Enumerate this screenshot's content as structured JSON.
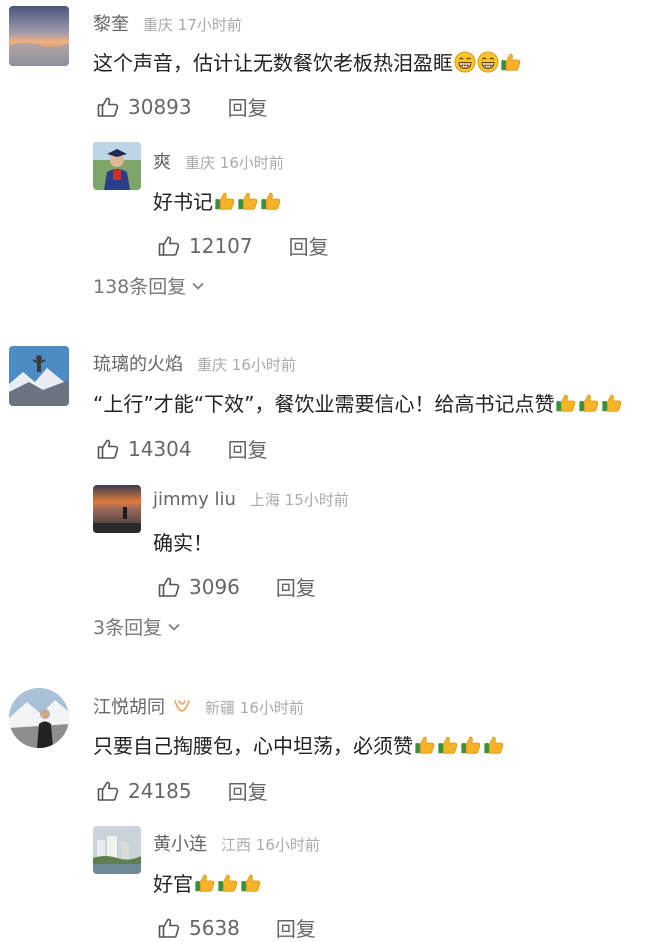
{
  "comments": [
    {
      "name": "黎奎",
      "location": "重庆",
      "time": "17小时前",
      "text": "这个声音，估计让无数餐饮老板热泪盈眶",
      "likes": "30893",
      "reply_label": "回复",
      "emoji": [
        "grin-emoji",
        "grin-emoji",
        "thumbs-up-emoji"
      ],
      "reply": {
        "name": "爽",
        "location": "重庆",
        "time": "16小时前",
        "text": "好书记",
        "likes": "12107",
        "reply_label": "回复",
        "emoji": [
          "thumbs-up-emoji",
          "thumbs-up-emoji",
          "thumbs-up-emoji"
        ]
      },
      "more_replies": "138条回复"
    },
    {
      "name": "琉璃的火焰",
      "location": "重庆",
      "time": "16小时前",
      "text": "“上行”才能“下效”，餐饮业需要信心！给高书记点赞",
      "likes": "14304",
      "reply_label": "回复",
      "emoji": [
        "thumbs-up-emoji",
        "thumbs-up-emoji",
        "thumbs-up-emoji"
      ],
      "reply": {
        "name": "jimmy liu",
        "location": "上海",
        "time": "15小时前",
        "text": "确实！",
        "likes": "3096",
        "reply_label": "回复",
        "emoji": []
      },
      "more_replies": "3条回复"
    },
    {
      "name": "江悦胡同",
      "location": "新疆",
      "time": "16小时前",
      "text": "只要自己掏腰包，心中坦荡，必须赞",
      "likes": "24185",
      "reply_label": "回复",
      "emoji": [
        "thumbs-up-emoji",
        "thumbs-up-emoji",
        "thumbs-up-emoji",
        "thumbs-up-emoji"
      ],
      "badge_icon": "vip-badge-icon",
      "reply": {
        "name": "黄小连",
        "location": "江西",
        "time": "16小时前",
        "text": "好官",
        "likes": "5638",
        "reply_label": "回复",
        "emoji": [
          "thumbs-up-emoji",
          "thumbs-up-emoji",
          "thumbs-up-emoji"
        ]
      }
    }
  ],
  "icons": {
    "like": "thumb-outline-icon",
    "expand": "chevron-down-icon"
  },
  "colors": {
    "name": "#666666",
    "meta": "#aaaaaa",
    "text": "#222222",
    "badge": "#f0a35a"
  }
}
